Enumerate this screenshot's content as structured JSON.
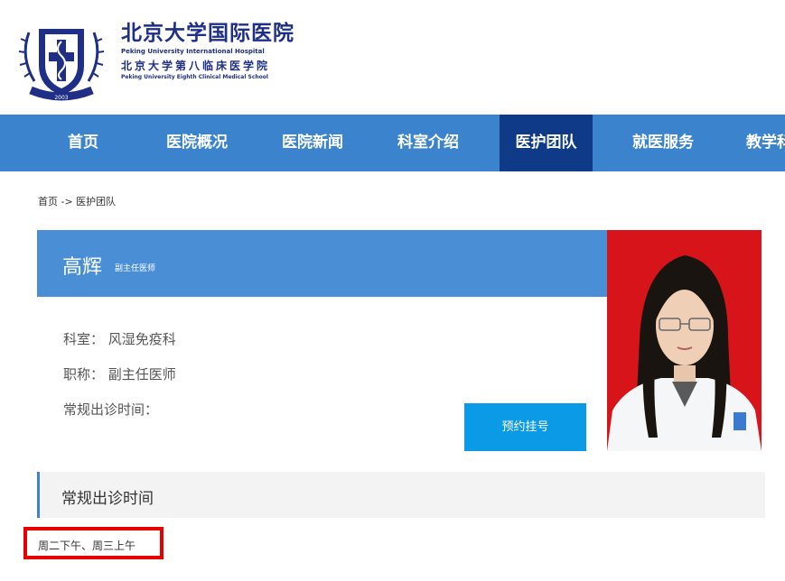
{
  "header": {
    "logo_cn": "北京大学国际医院",
    "logo_en": "Peking University International Hospital",
    "school_cn": "北京大学第八临床医学院",
    "school_en": "Peking University Eighth Clinical Medical School",
    "emblem_year": "2003",
    "brand_color": "#1f2f86"
  },
  "nav": {
    "items": [
      {
        "label": "首页"
      },
      {
        "label": "医院概况"
      },
      {
        "label": "医院新闻"
      },
      {
        "label": "科室介绍"
      },
      {
        "label": "医护团队"
      },
      {
        "label": "就医服务"
      },
      {
        "label": "教学科研"
      }
    ],
    "active_label": "医护团队",
    "bar_color": "#3b84cd",
    "active_color": "#0e3a88"
  },
  "breadcrumb": "首页 -> 医护团队",
  "doctor": {
    "name": "高辉",
    "title_small": "副主任医师",
    "department_line": "科室：  风湿免疫科",
    "title_line": "职称：  副主任医师",
    "schedule_line": "常规出诊时间："
  },
  "book_button": "预约挂号",
  "section": {
    "title": "常规出诊时间",
    "schedule": "周二下午、周三上午"
  }
}
